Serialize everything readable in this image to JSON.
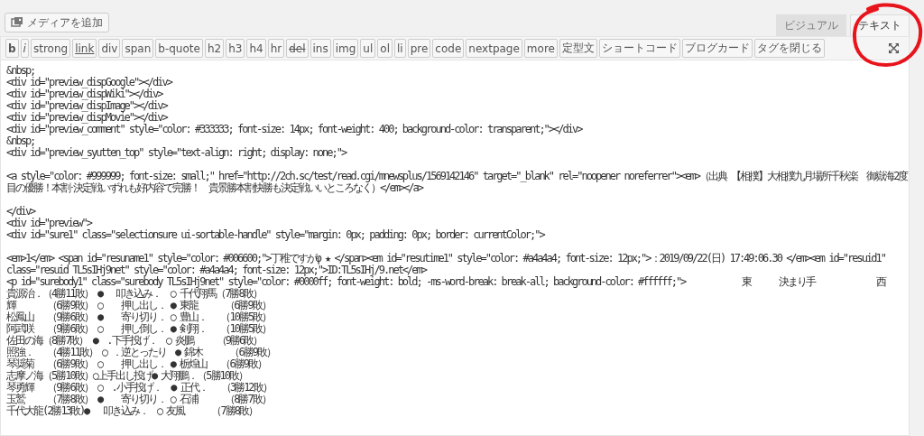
{
  "media_button": {
    "label": "メディアを追加"
  },
  "tabs": [
    {
      "label": "ビジュアル",
      "selected": false
    },
    {
      "label": "テキスト",
      "selected": true
    }
  ],
  "quicktags": [
    {
      "label": "b",
      "kind": "bold"
    },
    {
      "label": "i",
      "kind": "italic"
    },
    {
      "label": "strong",
      "kind": "plain"
    },
    {
      "label": "link",
      "kind": "link"
    },
    {
      "label": "div",
      "kind": "plain"
    },
    {
      "label": "span",
      "kind": "plain"
    },
    {
      "label": "b-quote",
      "kind": "plain"
    },
    {
      "label": "h2",
      "kind": "plain"
    },
    {
      "label": "h3",
      "kind": "plain"
    },
    {
      "label": "h4",
      "kind": "plain"
    },
    {
      "label": "hr",
      "kind": "plain"
    },
    {
      "label": "del",
      "kind": "strike"
    },
    {
      "label": "ins",
      "kind": "plain"
    },
    {
      "label": "img",
      "kind": "plain"
    },
    {
      "label": "ul",
      "kind": "plain"
    },
    {
      "label": "ol",
      "kind": "plain"
    },
    {
      "label": "li",
      "kind": "plain"
    },
    {
      "label": "pre",
      "kind": "plain"
    },
    {
      "label": "code",
      "kind": "plain"
    },
    {
      "label": "nextpage",
      "kind": "plain"
    },
    {
      "label": "more",
      "kind": "plain"
    },
    {
      "label": "定型文",
      "kind": "plain"
    },
    {
      "label": "ショートコード",
      "kind": "plain"
    },
    {
      "label": "ブログカード",
      "kind": "plain"
    },
    {
      "label": "タグを閉じる",
      "kind": "plain"
    }
  ],
  "editor_blocks": [
    {
      "lines": [
        "&nbsp;",
        "<div id=\"preview_dispGoogle\"></div>",
        "<div id=\"preview_dispWiki\"></div>",
        "<div id=\"preview_dispImage\"></div>",
        "<div id=\"preview_dispMovie\"></div>",
        "<div id=\"preview_comment\" style=\"color: #333333; font-size: 14px; font-weight: 400; background-color: transparent;\"></div>",
        "&nbsp;",
        "<div id=\"preview_syutten_top\" style=\"text-align: right; display: none;\">"
      ]
    },
    {
      "lines": [
        "<a style=\"color: #999999; font-size: small;\" href=\"http://2ch.sc/test/read.cgi/mnewsplus/1569142146\" target=\"_blank\" rel=\"noopener noreferrer\"><em>（出典 【相撲】大相撲九月場所千秋楽　御嶽海2度",
        "目の優勝！本割･決定戦いずれも好内容で完勝！　貴景勝本割快勝も決定戦いいところなく）</em></a>"
      ]
    },
    {
      "lines": [
        "</div>",
        "<div id=\"preview\">",
        "<div id=\"sure1\" class=\"selectionsure ui-sortable-handle\" style=\"margin: 0px; padding: 0px; border: currentColor;\">"
      ]
    },
    {
      "lines": [
        "<em>1</em> <span id=\"resuname1\" style=\"color: #006600;\">丁稚ですがφ ★ </span><em id=\"resutime1\" style=\"color: #a4a4a4; font-size: 12px;\">：2019/09/22(日) 17:49:06.30 </em><em id=\"resuid1\"",
        "class=\"resuid TL5sIHj9net\" style=\"color: #a4a4a4; font-size: 12px;\">ID:TL5sIHj/9.net</em>",
        "<p id=\"surebody1\" class=\"surebody TL5sIHj9net\" style=\"color: #0000ff; font-weight: bold; -ms-word-break: break-all; background-color: #ffffff;\">            東      決まり手             西",
        "貴源治．（4勝11敗） ●　 叩き込み．  ○ 千代翔馬（7勝8敗）",
        "輝　　　 （6勝9敗） ○　  押し出し． ● 東龍　　　（6勝9敗）",
        "松鳳山　 （9勝6敗） ●　  寄り切り． ○ 豊山．　 （10勝5敗）",
        "阿武咲　 （9勝6敗） ○　  押し倒し． ● 剣翔．　 （10勝5敗）",
        "佐田の海（8勝7敗） ●  .下手投げ．  ○ 炎鵬　　 （9勝6敗）",
        "照強．　 （4勝11敗） ○ ．逆とったり  ● 錦木　　　（6勝9敗）",
        "琴奨菊　 （6勝9敗） ○　  押し出し． ● 栃煌山　 （6勝9敗）",
        "志摩ノ海（5勝10敗）○上手出し投げ● 大翔鵬．（5勝10敗）",
        "琴勇輝　 （9勝6敗） ○  .小手投げ．  ● 正代．　 （3勝12敗）",
        "玉鷲　　 （7勝8敗） ●　  寄り切り． ○ 石浦　　　（8勝7敗）",
        "千代大龍(2勝13敗)●　 叩き込み．  ○ 友風　　　（7勝8敗）"
      ]
    }
  ]
}
